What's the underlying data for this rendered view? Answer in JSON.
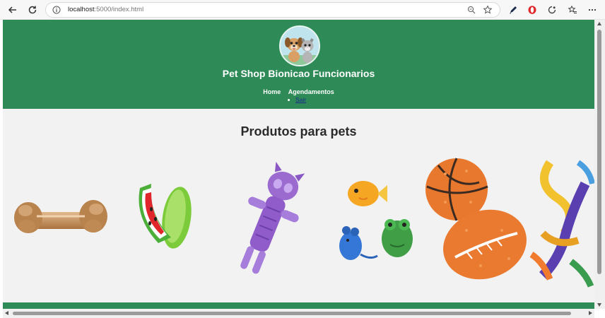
{
  "browser": {
    "url_host": "localhost",
    "url_rest": ":5000/index.html",
    "icons": [
      "back-icon",
      "reload-icon",
      "info-icon",
      "zoom-icon",
      "star-icon",
      "pen-icon",
      "opera-icon",
      "extensions-icon",
      "favorites-icon",
      "more-icon"
    ]
  },
  "header": {
    "title": "Pet Shop Bionicao Funcionarios",
    "nav": [
      "Home",
      "Agendamentos"
    ],
    "logout_label": "Sair",
    "background": "#2e8b57"
  },
  "main": {
    "section_title": "Produtos para pets",
    "products": [
      "bone-toy",
      "watermelon-toy",
      "purple-cat-toy",
      "fish-mouse-frog-toys",
      "ball-toys",
      "rope-toy"
    ]
  },
  "colors": {
    "brand_green": "#2e8b57",
    "page_bg": "#f2f2f2",
    "link": "#1a2a8c"
  }
}
